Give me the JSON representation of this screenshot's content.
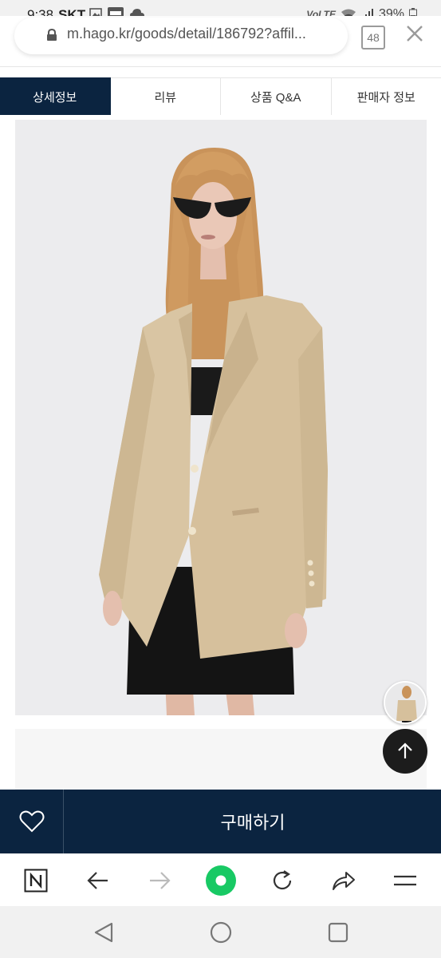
{
  "status_bar": {
    "time": "9:38",
    "carrier": "SKT",
    "network": "VoLTE",
    "battery": "39%"
  },
  "browser": {
    "url": "m.hago.kr/goods/detail/186792?affil...",
    "tab_count": "48"
  },
  "product_tabs": [
    {
      "label": "상세정보",
      "active": true
    },
    {
      "label": "리뷰",
      "active": false
    },
    {
      "label": "상품 Q&A",
      "active": false
    },
    {
      "label": "판매자 정보",
      "active": false
    }
  ],
  "buy_bar": {
    "buy_label": "구매하기"
  },
  "colors": {
    "navy": "#0b2440",
    "accent_green": "#18c964"
  },
  "icons": {
    "wishlist": "heart-icon",
    "scroll_top": "arrow-up-icon",
    "browser_nav": [
      "naver-icon",
      "back-icon",
      "forward-icon",
      "home-green-icon",
      "reload-icon",
      "share-icon",
      "menu-icon"
    ],
    "android_nav": [
      "android-back-icon",
      "android-home-icon",
      "android-recents-icon"
    ]
  }
}
